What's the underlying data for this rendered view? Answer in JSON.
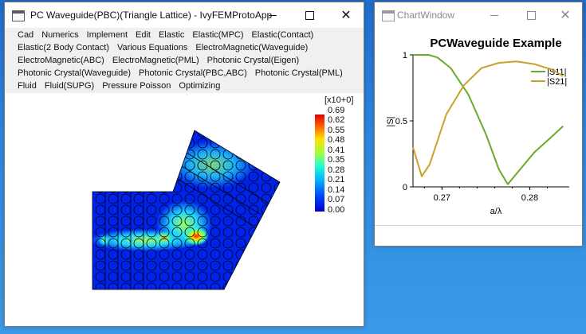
{
  "main_window": {
    "title": "PC Waveguide(PBC)(Triangle Lattice) - IvyFEMProtoApp",
    "menu_rows": [
      [
        "Cad",
        "Numerics",
        "Implement",
        "Edit",
        "Elastic",
        "Elastic(MPC)",
        "Elastic(Contact)"
      ],
      [
        "Elastic(2 Body Contact)",
        "Various Equations",
        "ElectroMagnetic(Waveguide)"
      ],
      [
        "ElectroMagnetic(ABC)",
        "ElectroMagnetic(PML)",
        "Photonic Crystal(Eigen)"
      ],
      [
        "Photonic Crystal(Waveguide)",
        "Photonic Crystal(PBC,ABC)",
        "Photonic Crystal(PML)"
      ],
      [
        "Fluid",
        "Fluid(SUPG)",
        "Pressure Poisson",
        "Optimizing"
      ]
    ],
    "colorbar": {
      "header": "[x10+0]",
      "ticks": [
        "0.69",
        "0.62",
        "0.55",
        "0.48",
        "0.41",
        "0.35",
        "0.28",
        "0.21",
        "0.14",
        "0.07",
        "0.00"
      ]
    }
  },
  "chart_window": {
    "title": "ChartWindow",
    "chart_data": {
      "type": "line",
      "title": "PCWaveguide Example",
      "xlabel": "a/λ",
      "ylabel": "|S|",
      "xlim": [
        0.2667,
        0.2845
      ],
      "ylim": [
        0,
        1
      ],
      "x_ticks": [
        "0.27",
        "0.28"
      ],
      "x_tick_values": [
        0.27,
        0.28
      ],
      "y_ticks": [
        "0",
        "0.5",
        "1"
      ],
      "y_tick_values": [
        0,
        0.5,
        1
      ],
      "legend_position": "top-right",
      "series": [
        {
          "name": "|S11|",
          "color": "#6aaa2a",
          "x": [
            0.2667,
            0.2685,
            0.2695,
            0.271,
            0.273,
            0.275,
            0.2765,
            0.2775,
            0.2785,
            0.2805,
            0.2825,
            0.2838
          ],
          "y": [
            1.0,
            1.0,
            0.98,
            0.9,
            0.7,
            0.4,
            0.13,
            0.02,
            0.1,
            0.26,
            0.38,
            0.46
          ]
        },
        {
          "name": "|S21|",
          "color": "#c8a22a",
          "x": [
            0.2667,
            0.2677,
            0.2686,
            0.2705,
            0.2725,
            0.2745,
            0.2765,
            0.2785,
            0.2805,
            0.2825,
            0.2838
          ],
          "y": [
            0.3,
            0.08,
            0.17,
            0.55,
            0.77,
            0.9,
            0.94,
            0.95,
            0.93,
            0.89,
            0.84
          ]
        }
      ]
    }
  }
}
